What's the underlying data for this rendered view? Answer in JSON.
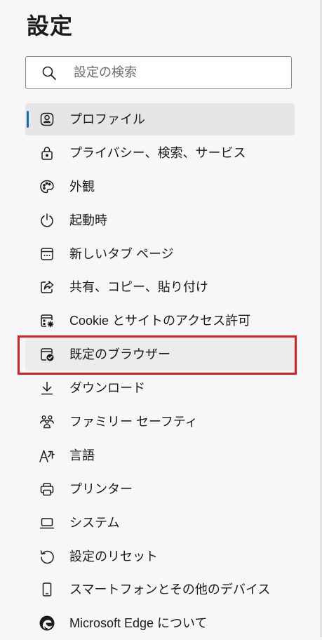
{
  "page_title": "設定",
  "search": {
    "placeholder": "設定の検索",
    "value": ""
  },
  "nav_items": [
    {
      "label": "プロファイル",
      "icon": "profile-icon",
      "selected": true
    },
    {
      "label": "プライバシー、検索、サービス",
      "icon": "lock-icon"
    },
    {
      "label": "外観",
      "icon": "palette-icon"
    },
    {
      "label": "起動時",
      "icon": "power-icon"
    },
    {
      "label": "新しいタブ ページ",
      "icon": "new-tab-icon"
    },
    {
      "label": "共有、コピー、貼り付け",
      "icon": "share-icon"
    },
    {
      "label": "Cookie とサイトのアクセス許可",
      "icon": "site-permissions-icon"
    },
    {
      "label": "既定のブラウザー",
      "icon": "default-browser-icon",
      "highlighted": true
    },
    {
      "label": "ダウンロード",
      "icon": "download-icon"
    },
    {
      "label": "ファミリー セーフティ",
      "icon": "family-icon"
    },
    {
      "label": "言語",
      "icon": "language-icon"
    },
    {
      "label": "プリンター",
      "icon": "printer-icon"
    },
    {
      "label": "システム",
      "icon": "laptop-icon"
    },
    {
      "label": "設定のリセット",
      "icon": "reset-icon"
    },
    {
      "label": "スマートフォンとその他のデバイス",
      "icon": "phone-icon"
    },
    {
      "label": "Microsoft Edge について",
      "icon": "edge-logo-icon"
    }
  ],
  "colors": {
    "accent": "#0f6cbd",
    "highlight_border": "#d8201f",
    "selected_bg": "#e6e6e6",
    "background": "#f7f7f7"
  }
}
